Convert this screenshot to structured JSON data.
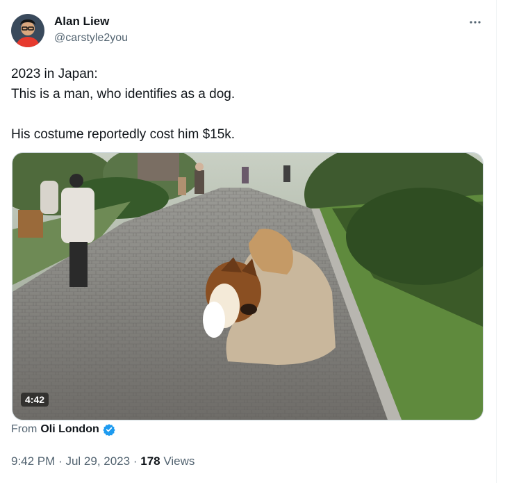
{
  "author": {
    "name": "Alan Liew",
    "handle": "@carstyle2you",
    "avatar_icon": "person-avatar"
  },
  "more_icon": "more-horizontal-icon",
  "tweet": {
    "lines": [
      "2023 in Japan:",
      "This is a man, who identifies as a dog.",
      "His costume reportedly cost him $15k."
    ]
  },
  "media": {
    "duration": "4:42"
  },
  "attribution": {
    "prefix": "From",
    "source": "Oli London",
    "verified_icon": "verified-badge-icon",
    "verified_color": "#1d9bf0"
  },
  "meta": {
    "time": "9:42 PM",
    "separator1": "·",
    "date": "Jul 29, 2023",
    "separator2": "·",
    "views_count": "178",
    "views_label": "Views"
  }
}
